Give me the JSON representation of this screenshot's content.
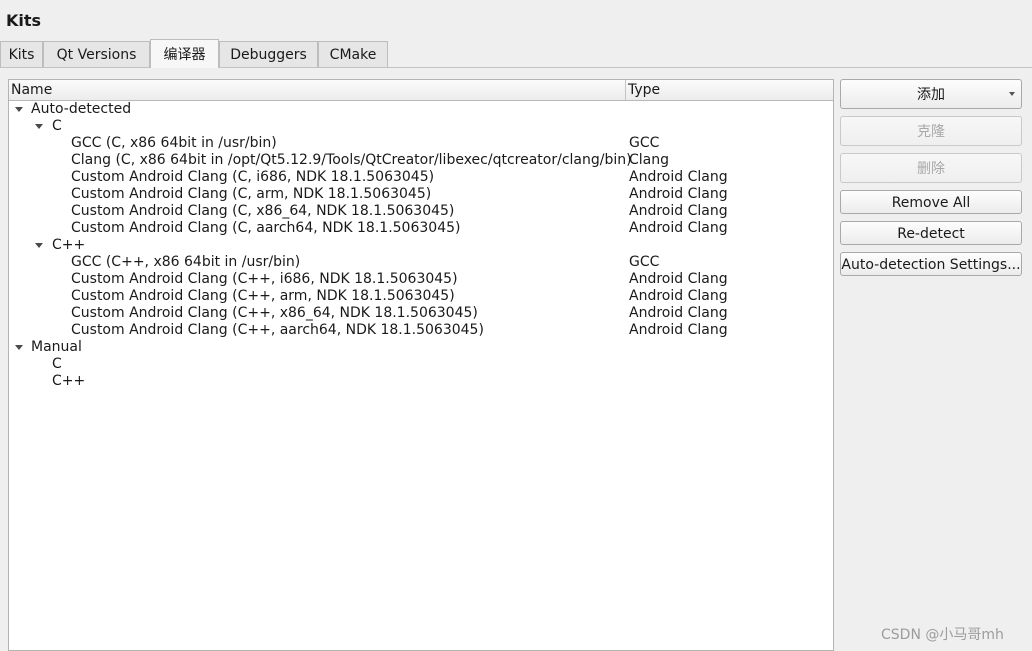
{
  "window": {
    "title": "Kits"
  },
  "tabs": [
    {
      "label": "Kits"
    },
    {
      "label": "Qt Versions"
    },
    {
      "label": "编译器"
    },
    {
      "label": "Debuggers"
    },
    {
      "label": "CMake"
    }
  ],
  "active_tab": "编译器",
  "tree": {
    "headers": {
      "name": "Name",
      "type": "Type"
    },
    "rows": [
      {
        "name": "Auto-detected",
        "type": "",
        "level": 0,
        "expanded": true
      },
      {
        "name": "C",
        "type": "",
        "level": 1,
        "expanded": true
      },
      {
        "name": "GCC (C, x86 64bit in /usr/bin)",
        "type": "GCC",
        "level": 2
      },
      {
        "name": "Clang (C, x86 64bit in /opt/Qt5.12.9/Tools/QtCreator/libexec/qtcreator/clang/bin)",
        "type": "Clang",
        "level": 2
      },
      {
        "name": "Custom Android Clang (C, i686, NDK 18.1.5063045)",
        "type": "Android Clang",
        "level": 2
      },
      {
        "name": "Custom Android Clang (C, arm, NDK 18.1.5063045)",
        "type": "Android Clang",
        "level": 2
      },
      {
        "name": "Custom Android Clang (C, x86_64, NDK 18.1.5063045)",
        "type": "Android Clang",
        "level": 2
      },
      {
        "name": "Custom Android Clang (C, aarch64, NDK 18.1.5063045)",
        "type": "Android Clang",
        "level": 2
      },
      {
        "name": "C++",
        "type": "",
        "level": 1,
        "expanded": true
      },
      {
        "name": "GCC (C++, x86 64bit in /usr/bin)",
        "type": "GCC",
        "level": 2
      },
      {
        "name": "Custom Android Clang (C++, i686, NDK 18.1.5063045)",
        "type": "Android Clang",
        "level": 2
      },
      {
        "name": "Custom Android Clang (C++, arm, NDK 18.1.5063045)",
        "type": "Android Clang",
        "level": 2
      },
      {
        "name": "Custom Android Clang (C++, x86_64, NDK 18.1.5063045)",
        "type": "Android Clang",
        "level": 2
      },
      {
        "name": "Custom Android Clang (C++, aarch64, NDK 18.1.5063045)",
        "type": "Android Clang",
        "level": 2
      },
      {
        "name": "Manual",
        "type": "",
        "level": 0,
        "expanded": true
      },
      {
        "name": "C",
        "type": "",
        "level": 1
      },
      {
        "name": "C++",
        "type": "",
        "level": 1
      }
    ]
  },
  "buttons": {
    "add": {
      "label": "添加",
      "enabled": true
    },
    "clone": {
      "label": "克隆",
      "enabled": false
    },
    "remove": {
      "label": "删除",
      "enabled": false
    },
    "remove_all": {
      "label": "Remove All",
      "enabled": true
    },
    "redetect": {
      "label": "Re-detect",
      "enabled": true
    },
    "auto_settings": {
      "label": "Auto-detection Settings...",
      "enabled": true
    }
  },
  "watermark": "CSDN @小马哥mh"
}
